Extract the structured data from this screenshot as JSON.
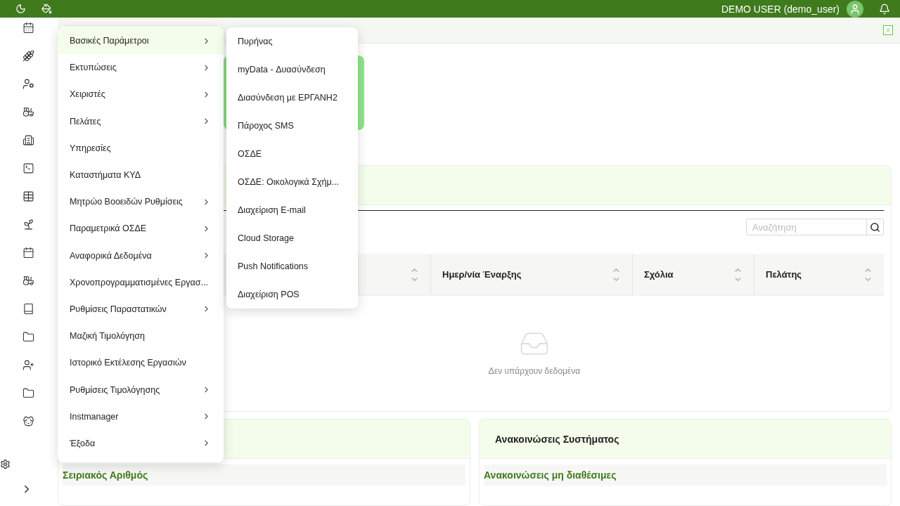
{
  "top_bar": {
    "user": "DEMO USER (demo_user)"
  },
  "menu": {
    "items": [
      {
        "label": "Βασικές Παράμετροι",
        "submenu": true,
        "selected": true
      },
      {
        "label": "Εκτυπώσεις",
        "submenu": true,
        "selected": false
      },
      {
        "label": "Χειριστές",
        "submenu": true,
        "selected": false
      },
      {
        "label": "Πελάτες",
        "submenu": true,
        "selected": false
      },
      {
        "label": "Υπηρεσίες",
        "submenu": false,
        "selected": false
      },
      {
        "label": "Καταστήματα ΚΥΔ",
        "submenu": false,
        "selected": false
      },
      {
        "label": "Μητρώο Βοοειδών Ρυθμίσεις",
        "submenu": true,
        "selected": false
      },
      {
        "label": "Παραμετρικά ΟΣΔΕ",
        "submenu": true,
        "selected": false
      },
      {
        "label": "Αναφορικά Δεδομένα",
        "submenu": true,
        "selected": false
      },
      {
        "label": "Χρονοπρογραμματισμένες Εργασ...",
        "submenu": false,
        "selected": false
      },
      {
        "label": "Ρυθμίσεις Παραστατικών",
        "submenu": true,
        "selected": false
      },
      {
        "label": "Μαζική Τιμολόγηση",
        "submenu": false,
        "selected": false
      },
      {
        "label": "Ιστορικό Εκτέλεσης Εργασιών",
        "submenu": false,
        "selected": false
      },
      {
        "label": "Ρυθμίσεις Τιμολόγησης",
        "submenu": true,
        "selected": false
      },
      {
        "label": "Instmanager",
        "submenu": true,
        "selected": false
      },
      {
        "label": "Έξοδα",
        "submenu": true,
        "selected": false
      }
    ]
  },
  "submenu": {
    "items": [
      "Πυρήνας",
      "myData - Δυασύνδεση",
      "Διασύνδεση με ΕΡΓΑΝΗ2",
      "Πάροχος SMS",
      "ΟΣΔΕ",
      "ΟΣΔΕ: Οικολογικά Σχήμ...",
      "Διαχείριση E-mail",
      "Cloud Storage",
      "Push Notifications",
      "Διαχείριση POS"
    ]
  },
  "table": {
    "search": {
      "placeholder": "Αναζήτηση"
    },
    "columns": [
      {},
      {
        "label": "Ημερ/νία Έναρξης"
      },
      {
        "label": "Σχόλια"
      },
      {
        "label": "Πελάτης"
      }
    ],
    "empty": "Δεν υπάρχουν δεδομένα"
  },
  "serial_card": {
    "subheading": "Σειριακός Αριθμός"
  },
  "announcements": {
    "title": "Ανακοινώσεις Συστήματος",
    "subheading": "Ανακοινώσεις μη διαθέσιμες"
  }
}
